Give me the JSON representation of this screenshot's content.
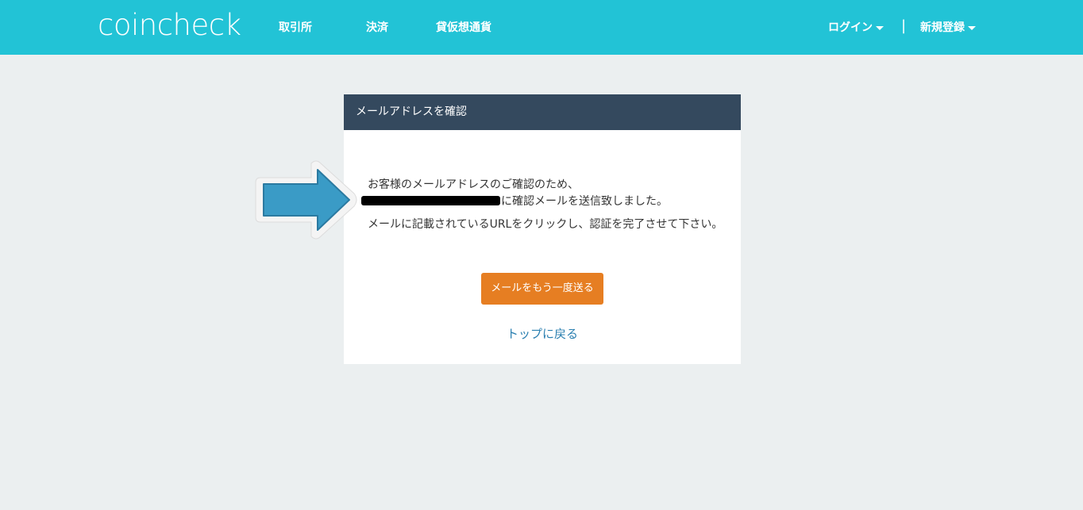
{
  "header": {
    "logo": "coincheck",
    "nav": {
      "exchange": "取引所",
      "payment": "決済",
      "lending": "貸仮想通貨"
    },
    "login": "ログイン",
    "separator": "|",
    "signup": "新規登録"
  },
  "card": {
    "title": "メールアドレスを確認",
    "message_line1": "お客様のメールアドレスのご確認のため、",
    "message_line2": "に確認メールを送信致しました。",
    "message_line3": "メールに記載されているURLをクリックし、認証を完了させて下さい。",
    "resend_button": "メールをもう一度送る",
    "top_link": "トップに戻る"
  },
  "colors": {
    "header_bg": "#22c3d6",
    "card_header_bg": "#34495e",
    "button_bg": "#e67e22",
    "link": "#2a7fb0",
    "arrow": "#3a9bc6"
  },
  "icons": {
    "annotation_arrow": "arrow-right-icon",
    "dropdown": "caret-down-icon"
  }
}
